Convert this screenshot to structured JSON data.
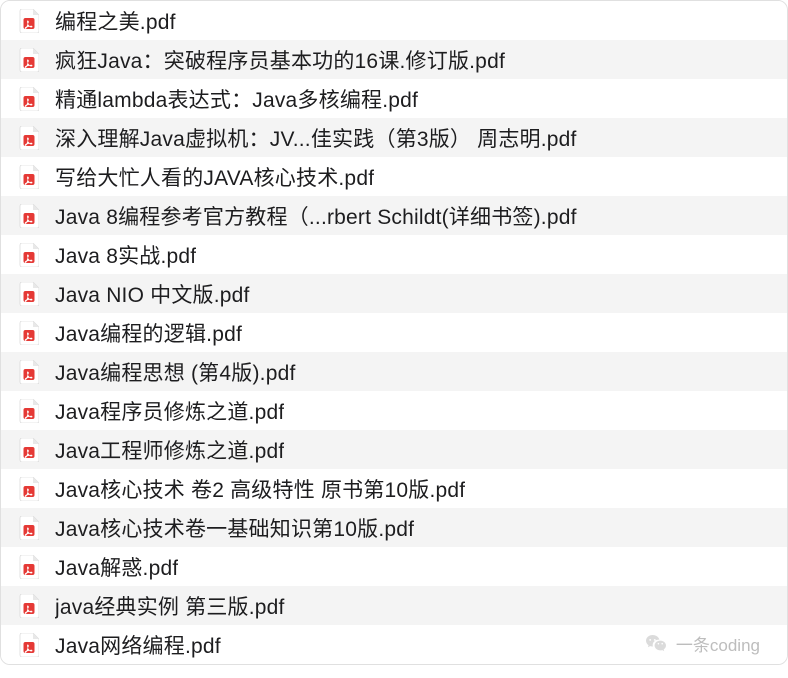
{
  "files": [
    {
      "name": "编程之美.pdf"
    },
    {
      "name": "疯狂Java：突破程序员基本功的16课.修订版.pdf"
    },
    {
      "name": "精通lambda表达式：Java多核编程.pdf"
    },
    {
      "name": "深入理解Java虚拟机：JV...佳实践（第3版） 周志明.pdf"
    },
    {
      "name": "写给大忙人看的JAVA核心技术.pdf"
    },
    {
      "name": "Java 8编程参考官方教程（...rbert Schildt(详细书签).pdf"
    },
    {
      "name": "Java 8实战.pdf"
    },
    {
      "name": "Java NIO 中文版.pdf"
    },
    {
      "name": "Java编程的逻辑.pdf"
    },
    {
      "name": "Java编程思想 (第4版).pdf"
    },
    {
      "name": "Java程序员修炼之道.pdf"
    },
    {
      "name": "Java工程师修炼之道.pdf"
    },
    {
      "name": "Java核心技术 卷2 高级特性 原书第10版.pdf"
    },
    {
      "name": "Java核心技术卷一基础知识第10版.pdf"
    },
    {
      "name": "Java解惑.pdf"
    },
    {
      "name": "java经典实例 第三版.pdf"
    },
    {
      "name": "Java网络编程.pdf"
    }
  ],
  "watermark": {
    "label": "一条coding"
  }
}
